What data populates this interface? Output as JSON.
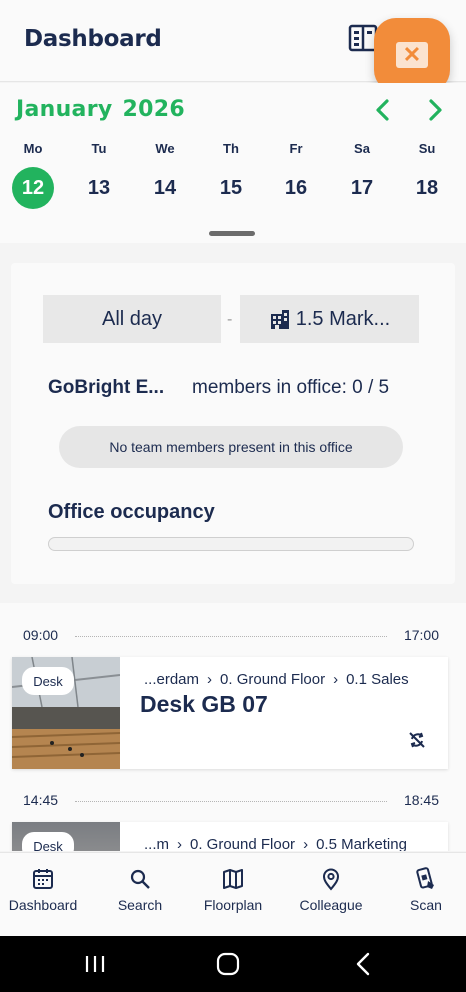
{
  "header": {
    "title": "Dashboard"
  },
  "calendar": {
    "month": "January",
    "year": "2026",
    "weekdays": [
      "Mo",
      "Tu",
      "We",
      "Th",
      "Fr",
      "Sa",
      "Su"
    ],
    "days": [
      "12",
      "13",
      "14",
      "15",
      "16",
      "17",
      "18"
    ],
    "selected_day": "12"
  },
  "occupancy_card": {
    "time_filter": "All day",
    "building_filter": "1.5 Mark...",
    "team_name": "GoBright E...",
    "members_in_office": "members in office: 0 / 5",
    "empty_message": "No team members present in this office",
    "occupancy_title": "Office occupancy",
    "occupancy_fraction": 0
  },
  "bookings": [
    {
      "start": "09:00",
      "end": "17:00",
      "tag": "Desk",
      "crumb_1": "...erdam",
      "crumb_2": "0. Ground Floor",
      "crumb_3": "0.1 Sales",
      "name": "Desk GB 07"
    },
    {
      "start": "14:45",
      "end": "18:45",
      "tag": "Desk",
      "crumb_1": "...m",
      "crumb_2": "0. Ground Floor",
      "crumb_3": "0.5 Marketing"
    }
  ],
  "nav": {
    "dashboard": "Dashboard",
    "search": "Search",
    "floorplan": "Floorplan",
    "colleague": "Colleague",
    "scan": "Scan"
  },
  "colors": {
    "accent_green": "#22b35e",
    "navy": "#1c2b4f",
    "fab_orange": "#f28c3a"
  }
}
